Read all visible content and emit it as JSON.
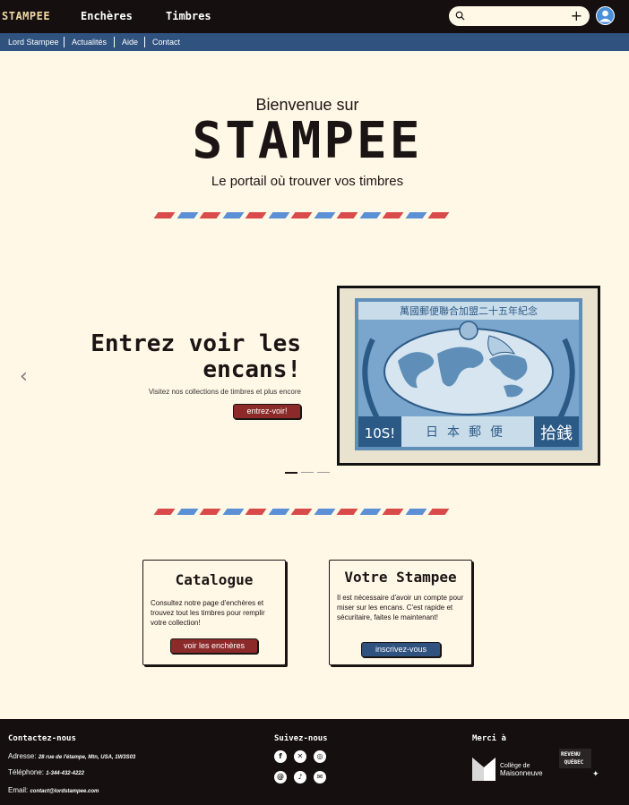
{
  "header": {
    "logo": "STAMPEE",
    "nav": [
      "Enchères",
      "Timbres"
    ],
    "search_icon": "search-icon",
    "add_icon": "plus-icon",
    "avatar_icon": "user-avatar-icon"
  },
  "subnav": [
    "Lord Stampee",
    "Actualités",
    "Aide",
    "Contact"
  ],
  "hero": {
    "welcome": "Bienvenue sur",
    "title": "STAMPEE",
    "tagline": "Le portail où trouver vos timbres"
  },
  "carousel": {
    "title": "Entrez voir les encans!",
    "description": "Visitez nos collections de timbres et plus encore",
    "button": "entrez-voir!",
    "prev_icon": "chevron-left-icon",
    "next_icon": "chevron-right-icon",
    "stamp": {
      "top_text": "萬國郵便聯合加盟二十五年紀念",
      "value": "10S!",
      "bottom_text": "日本郵便",
      "value_kanji": "拾銭"
    }
  },
  "cards": [
    {
      "title": "Catalogue",
      "text": "Consultez notre page d'enchères et trouvez tout les timbres pour remplir votre collection!",
      "button": "voir les enchères"
    },
    {
      "title": "Votre Stampee",
      "text": "Il est nécessaire d'avoir un compte pour miser sur les encans. C'est rapide et sécuritaire, faites le maintenant!",
      "button": "inscrivez-vous"
    }
  ],
  "footer": {
    "contact_heading": "Contactez-nous",
    "address_label": "Adresse:",
    "address_value": "28 rue de l'étampe, Mtn, USA, 1W3S03",
    "phone_label": "Téléphone:",
    "phone_value": "1-344-432-4222",
    "email_label": "Email:",
    "email_value": "contact@lordstampee.com",
    "social_heading": "Suivez-nous",
    "social_icons": [
      "facebook-icon",
      "x-icon",
      "instagram-icon",
      "threads-icon",
      "tiktok-icon",
      "mail-icon"
    ],
    "thanks_heading": "Merci à",
    "college_line1": "Collège de",
    "college_line2": "Maisonneuve",
    "revenu_line1": "REVENU",
    "revenu_line2": "QUÉBEC"
  },
  "colors": {
    "dark": "#150f0f",
    "cream": "#fff8e6",
    "blue": "#2f527f",
    "red": "#8c2a2a",
    "stripe_red": "#d94a4a",
    "stripe_blue": "#5b8fd6"
  }
}
